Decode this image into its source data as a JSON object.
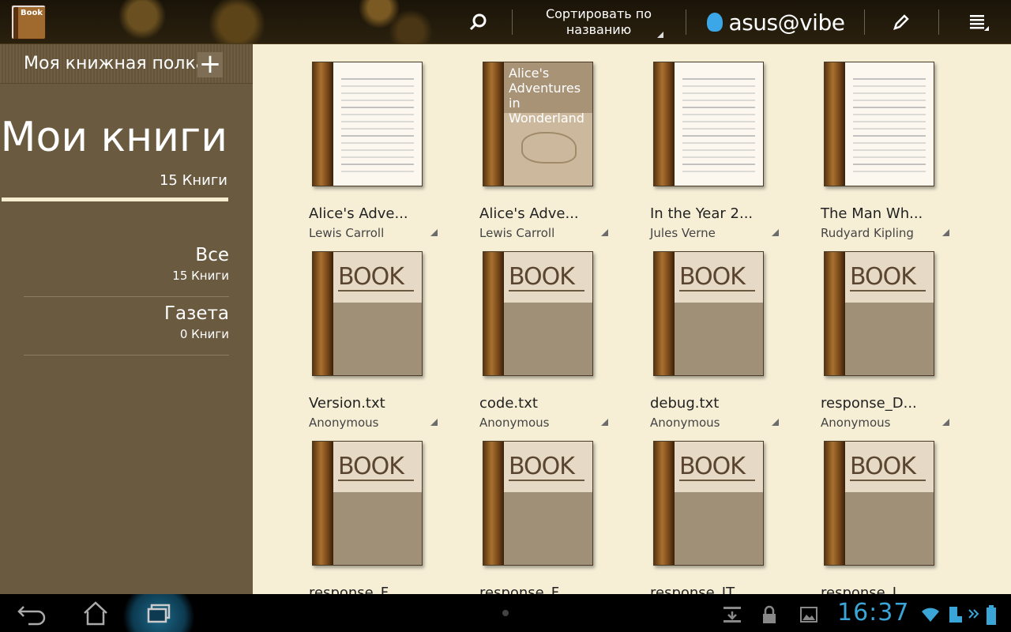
{
  "actionbar": {
    "app_icon_label": "Book",
    "sort_line1": "Сортировать по",
    "sort_line2": "названию",
    "brand": "asus@vibe"
  },
  "sidebar": {
    "shelf_title": "Моя книжная полка",
    "header_title": "Мои книги",
    "header_count": "15 Книги",
    "categories": [
      {
        "name": "Все",
        "count": "15 Книги"
      },
      {
        "name": "Газета",
        "count": "0 Книги"
      }
    ]
  },
  "books": [
    {
      "title": "Alice's Adve...",
      "author": "Lewis Carroll",
      "cover": "page"
    },
    {
      "title": "Alice's Adve...",
      "author": "Lewis Carroll",
      "cover": "alice",
      "cover_text": "Alice's Adventures in Wonderland"
    },
    {
      "title": "In the Year 2...",
      "author": "Jules Verne",
      "cover": "page"
    },
    {
      "title": "The Man Wh...",
      "author": "Rudyard Kipling",
      "cover": "page"
    },
    {
      "title": "Version.txt",
      "author": "Anonymous",
      "cover": "book"
    },
    {
      "title": "code.txt",
      "author": "Anonymous",
      "cover": "book"
    },
    {
      "title": "debug.txt",
      "author": "Anonymous",
      "cover": "book"
    },
    {
      "title": "response_D...",
      "author": "Anonymous",
      "cover": "book"
    },
    {
      "title": "response_F...",
      "author": "",
      "cover": "book"
    },
    {
      "title": "response_F...",
      "author": "",
      "cover": "book"
    },
    {
      "title": "response_IT...",
      "author": "",
      "cover": "book"
    },
    {
      "title": "response_I...",
      "author": "",
      "cover": "book"
    }
  ],
  "book_stamp": "BOOK",
  "systembar": {
    "clock": "16:37"
  }
}
